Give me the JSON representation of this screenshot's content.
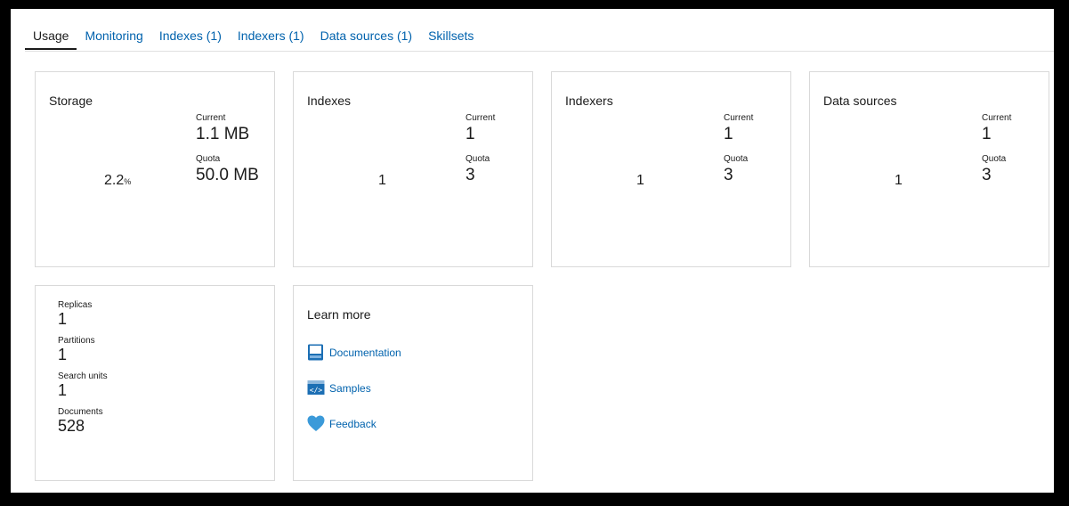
{
  "tabs": [
    {
      "label": "Usage",
      "active": true
    },
    {
      "label": "Monitoring"
    },
    {
      "label": "Indexes (1)"
    },
    {
      "label": "Indexers (1)"
    },
    {
      "label": "Data sources (1)"
    },
    {
      "label": "Skillsets"
    }
  ],
  "storage": {
    "title": "Storage",
    "current_label": "Current",
    "current_value": "1.1 MB",
    "quota_label": "Quota",
    "quota_value": "50.0 MB",
    "percent": "2.2",
    "percent_unit": "%"
  },
  "indexes": {
    "title": "Indexes",
    "current_label": "Current",
    "current_value": "1",
    "quota_label": "Quota",
    "quota_value": "3",
    "center_value": "1"
  },
  "indexers": {
    "title": "Indexers",
    "current_label": "Current",
    "current_value": "1",
    "quota_label": "Quota",
    "quota_value": "3",
    "center_value": "1"
  },
  "datasources": {
    "title": "Data sources",
    "current_label": "Current",
    "current_value": "1",
    "quota_label": "Quota",
    "quota_value": "3",
    "center_value": "1"
  },
  "service": {
    "replicas_label": "Replicas",
    "replicas_value": "1",
    "partitions_label": "Partitions",
    "partitions_value": "1",
    "search_units_label": "Search units",
    "search_units_value": "1",
    "documents_label": "Documents",
    "documents_value": "528"
  },
  "learn_more": {
    "title": "Learn more",
    "documentation_label": "Documentation",
    "samples_label": "Samples",
    "feedback_label": "Feedback"
  },
  "colors": {
    "link": "#0062ad",
    "icon_blue": "#1c6fb4",
    "heart_blue": "#3b9ad9"
  }
}
